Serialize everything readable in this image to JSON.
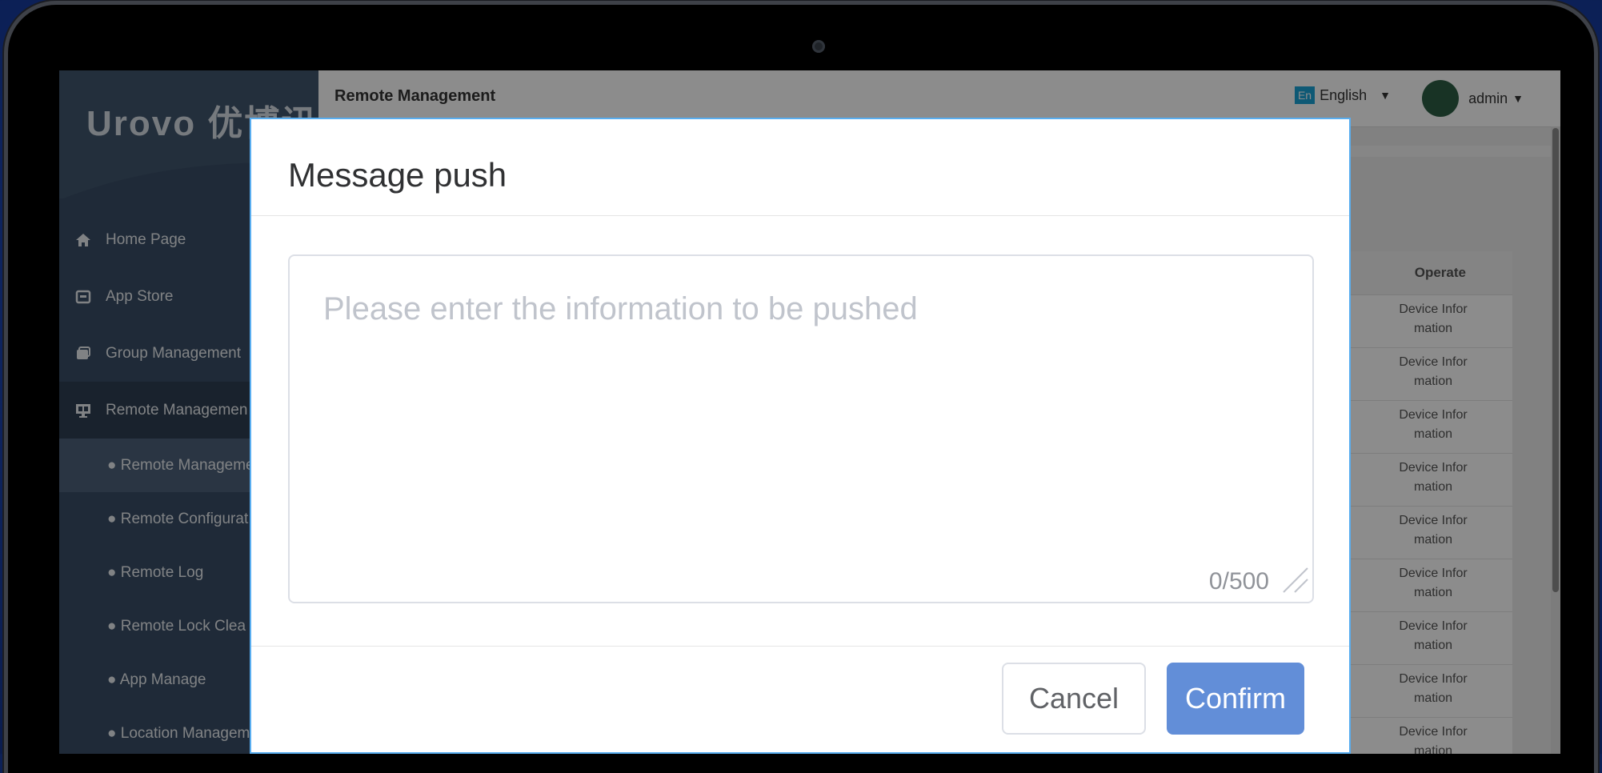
{
  "app": {
    "logo_text": "Urovo 优博讯",
    "header_title": "Remote Management",
    "language": {
      "badge": "En",
      "label": "English"
    },
    "user": {
      "name": "admin"
    }
  },
  "sidebar": {
    "items": [
      {
        "label": "Home Page",
        "icon": "home-icon"
      },
      {
        "label": "App Store",
        "icon": "store-icon"
      },
      {
        "label": "Group Management",
        "icon": "group-icon"
      },
      {
        "label": "Remote Managemen",
        "icon": "monitor-icon"
      }
    ],
    "sub_items": [
      {
        "label": "● Remote Manageme"
      },
      {
        "label": "● Remote Configurat"
      },
      {
        "label": "● Remote Log"
      },
      {
        "label": "● Remote Lock Clea"
      },
      {
        "label": "● App Manage"
      },
      {
        "label": "● Location Managem"
      }
    ]
  },
  "table": {
    "operate_header": "Operate",
    "row_action": "Device Information",
    "rows": [
      {
        "line1": "Device Infor",
        "line2": "mation"
      },
      {
        "line1": "Device Infor",
        "line2": "mation"
      },
      {
        "line1": "Device Infor",
        "line2": "mation"
      },
      {
        "line1": "Device Infor",
        "line2": "mation"
      },
      {
        "line1": "Device Infor",
        "line2": "mation"
      },
      {
        "line1": "Device Infor",
        "line2": "mation"
      },
      {
        "line1": "Device Infor",
        "line2": "mation"
      },
      {
        "line1": "Device Infor",
        "line2": "mation"
      },
      {
        "line1": "Device Infor",
        "line2": "mation"
      }
    ]
  },
  "modal": {
    "title": "Message push",
    "textarea": {
      "value": "",
      "placeholder": "Please enter the information to be pushed"
    },
    "counter": "0/500",
    "cancel_label": "Cancel",
    "confirm_label": "Confirm"
  },
  "colors": {
    "accent": "#628ed8",
    "modal_border": "#59aef0",
    "sidebar": "#3a4e66",
    "language_badge": "#1aa3d6"
  }
}
